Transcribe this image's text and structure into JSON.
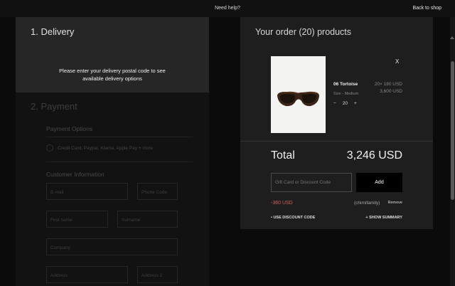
{
  "topbar": {
    "help": "Need help?",
    "back": "Back to shop"
  },
  "delivery": {
    "title": "1. Delivery",
    "message_line1": "Please enter your delivery postal code to see",
    "message_line2": "available delivery options"
  },
  "payment": {
    "title": "2. Payment",
    "options_label": "Payment Options",
    "methods": "Credit Card, Paypal, Klarna, Apple Pay + more",
    "customer_label": "Customer Information",
    "fields": {
      "email": "E-mail",
      "phone_code": "Phone Code",
      "first_name": "First name",
      "last_name": "Surname",
      "company": "Company",
      "address": "Address",
      "address2": "Address 2"
    }
  },
  "order": {
    "title": "Your order (20) products",
    "remove_icon": "X",
    "product": {
      "name": "06 Tortoise",
      "size": "Size - Medium",
      "qty_minus": "−",
      "qty": "20",
      "qty_plus": "+",
      "unit_price": "20× 180 USD",
      "line_total": "3,600 USD"
    },
    "total_label": "Total",
    "total_value": "3,246 USD",
    "code_placeholder": "Gift Card or Discount Code",
    "add_label": "Add",
    "discount_amount": "-360 USD",
    "discount_code": "(chimifamily)",
    "remove_label": "Remove",
    "use_code_label": "• USE DISCOUNT CODE",
    "show_summary_label": "+ SHOW SUMMARY"
  },
  "colors": {
    "accent_discount": "#d0625a",
    "panel": "#1e1e1e",
    "button": "#000000"
  }
}
